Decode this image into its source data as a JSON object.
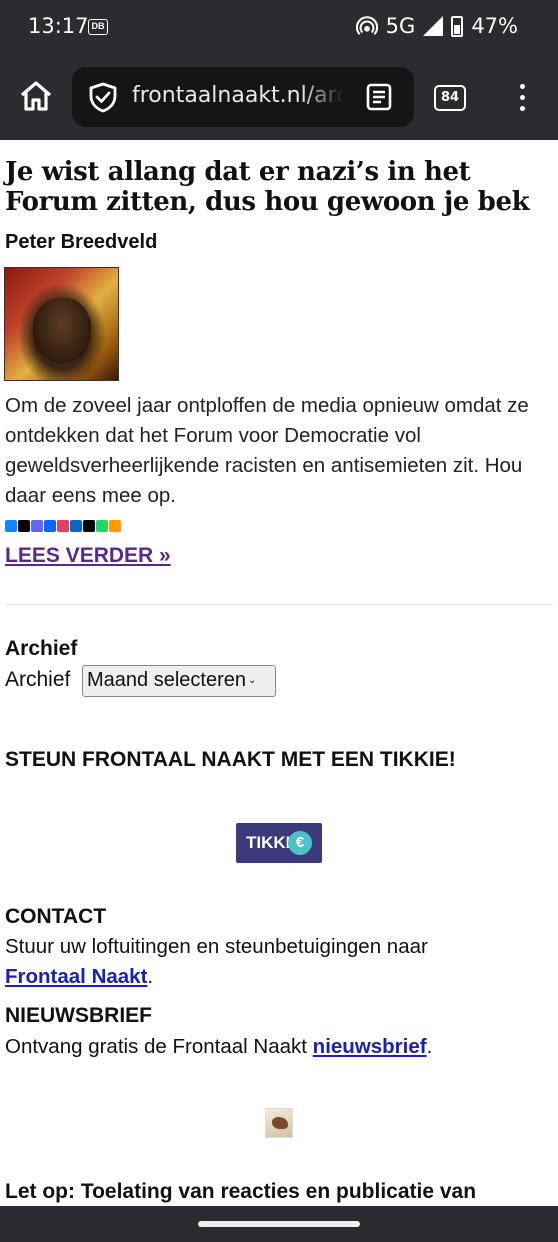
{
  "status_bar": {
    "time": "13:17",
    "db_badge": "DB",
    "network": "5G",
    "battery": "47%",
    "icons": [
      "hotspot-icon",
      "signal-icon",
      "battery-icon"
    ]
  },
  "browser": {
    "url": "frontaalnaakt.nl/archief",
    "tab_count": "84",
    "icons": [
      "home-icon",
      "shield-icon",
      "reader-mode-icon",
      "tabs-icon",
      "more-menu-icon"
    ]
  },
  "post": {
    "title": "Je wist allang dat er nazi’s in het Forum zitten, dus hou gewoon je bek",
    "author": "Peter Breedveld",
    "excerpt": "Om de zoveel jaar ontploffen de media opnieuw omdat ze ontdekken dat het Forum voor Democratie vol geweldsverheerlijkende racisten en antisemieten zit. Hou daar eens mee op.",
    "share_buttons": [
      {
        "name": "bluesky",
        "color": "#1185fe"
      },
      {
        "name": "x",
        "color": "#000000"
      },
      {
        "name": "mastodon",
        "color": "#6364ff"
      },
      {
        "name": "facebook",
        "color": "#0866ff"
      },
      {
        "name": "instagram",
        "color": "#e4405f"
      },
      {
        "name": "linkedin",
        "color": "#0a66c2"
      },
      {
        "name": "threads",
        "color": "#000000"
      },
      {
        "name": "whatsapp",
        "color": "#25d366"
      },
      {
        "name": "more",
        "color": "#ff9900"
      }
    ],
    "read_more": "LEES VERDER »"
  },
  "widgets": {
    "archief": {
      "title": "Archief",
      "label": "Archief",
      "select_value": "Maand selecteren"
    },
    "tikkie": {
      "title": "STEUN FRONTAAL NAAKT MET EEN TIKKIE!",
      "logo_text": "TIKKI",
      "logo_symbol": "€"
    },
    "contact": {
      "title": "CONTACT",
      "text": "Stuur uw loftuitingen en steunbetuigingen naar",
      "link": "Frontaal Naakt",
      "suffix": "."
    },
    "newsletter": {
      "title": "NIEUWSBRIEF",
      "text": "Ontvang gratis de Frontaal Naakt",
      "link": "nieuwsbrief",
      "suffix": "."
    },
    "notice": {
      "title": "Let op: Toelating van reacties en publicatie van"
    }
  },
  "colors": {
    "chrome": "#2a2c30",
    "link": "#1a20b8",
    "visited_link": "#5a2a8a",
    "tikkie": "#3b3a7a"
  }
}
